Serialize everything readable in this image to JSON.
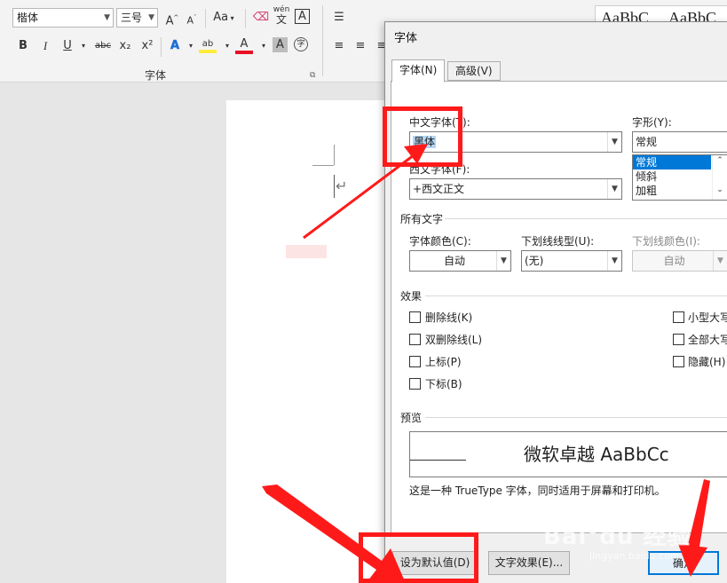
{
  "ribbon": {
    "font_name": "楷体",
    "font_size": "三号",
    "font_group_label": "字体",
    "style_samples": [
      "AaBbC",
      "AaBbC"
    ],
    "buttons": {
      "bold": "B",
      "italic": "I",
      "underline": "U",
      "strikethrough": "abc",
      "subscript": "x₂",
      "superscript": "x²",
      "font_color": "A",
      "grow_font": "A",
      "shrink_font": "A",
      "change_case": "Aa",
      "char_border": "A",
      "char_shading": "A",
      "text_effects": "A",
      "phonetic_guide_top": "wén",
      "phonetic_guide": "文"
    }
  },
  "dialog": {
    "title": "字体",
    "tabs": [
      "字体(N)",
      "高级(V)"
    ],
    "chinese_font_label": "中文字体(T):",
    "chinese_font_value": "黑体",
    "western_font_label": "西文字体(F):",
    "western_font_value": "+西文正文",
    "style_label": "字形(Y):",
    "style_value": "常规",
    "style_options": [
      "常规",
      "倾斜",
      "加粗"
    ],
    "all_text_section": "所有文字",
    "font_color_label": "字体颜色(C):",
    "font_color_value": "自动",
    "underline_type_label": "下划线线型(U):",
    "underline_type_value": "(无)",
    "underline_color_label": "下划线颜色(I):",
    "underline_color_value": "自动",
    "effects_section": "效果",
    "effects_left": [
      "删除线(K)",
      "双删除线(L)",
      "上标(P)",
      "下标(B)"
    ],
    "effects_right": [
      "小型大写",
      "全部大写",
      "隐藏(H)"
    ],
    "preview_section": "预览",
    "preview_text": "微软卓越  AaBbCc",
    "preview_note": "这是一种 TrueType 字体，同时适用于屏幕和打印机。",
    "set_default_button": "设为默认值(D)",
    "text_effects_button": "文字效果(E)...",
    "ok_button": "确定"
  },
  "watermark": {
    "brand": "Bai°du 经验",
    "url": "jingyan.baidu.com"
  },
  "colors": {
    "annotation_red": "#ff1a1a",
    "selection_blue": "#0078d7",
    "font_color_bar": "#e81123",
    "highlight_bar": "#ffeb3b"
  }
}
